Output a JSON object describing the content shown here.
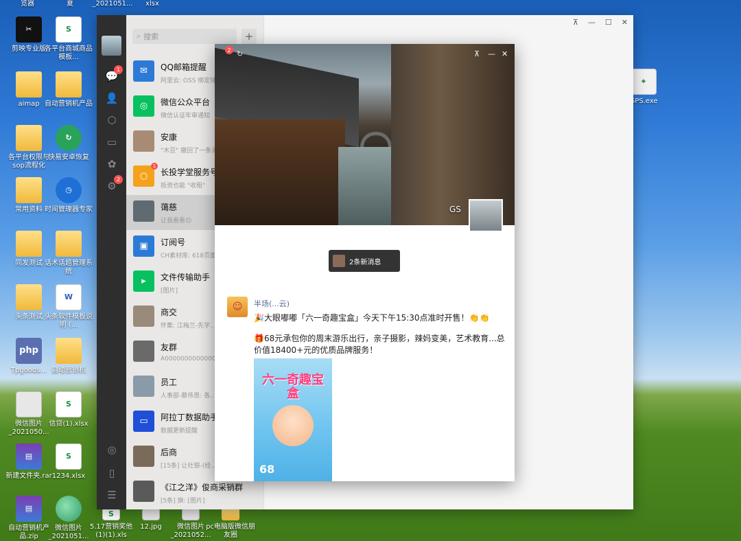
{
  "desktop": {
    "icons": [
      {
        "label": "剪映专业版",
        "kind": "capcut",
        "glyph": "✂"
      },
      {
        "label": "各平台商城商品模板...",
        "kind": "excel",
        "glyph": "S"
      },
      {
        "label": "aimap",
        "kind": "folder",
        "glyph": ""
      },
      {
        "label": "自动营销机产品",
        "kind": "folder",
        "glyph": ""
      },
      {
        "label": "各平台权限与sop流程化",
        "kind": "folder",
        "glyph": ""
      },
      {
        "label": "快易安卓恢复",
        "kind": "recover",
        "glyph": "↻"
      },
      {
        "label": "常用资料",
        "kind": "folder",
        "glyph": ""
      },
      {
        "label": "时间管理器专家",
        "kind": "clock",
        "glyph": "◷"
      },
      {
        "label": "同发测试",
        "kind": "folder",
        "glyph": ""
      },
      {
        "label": "话术话题管理系统",
        "kind": "folder",
        "glyph": ""
      },
      {
        "label": "头条测试",
        "kind": "folder",
        "glyph": ""
      },
      {
        "label": "头条软件模板说明 (...",
        "kind": "word",
        "glyph": "W"
      },
      {
        "label": "Tpgoods...",
        "kind": "php",
        "glyph": "php"
      },
      {
        "label": "自动营销机",
        "kind": "folder",
        "glyph": ""
      },
      {
        "label": "微信图片_2021050...",
        "kind": "img",
        "glyph": ""
      },
      {
        "label": "信贷(1).xlsx",
        "kind": "excel",
        "glyph": "S"
      },
      {
        "label": "新建文件夹.rar",
        "kind": "rar",
        "glyph": "▤"
      },
      {
        "label": "1234.xlsx",
        "kind": "excel",
        "glyph": "S"
      },
      {
        "label": "自动营销机产品.zip",
        "kind": "rar",
        "glyph": "▤"
      },
      {
        "label": "微信图片_2021051...",
        "kind": "ball",
        "glyph": ""
      },
      {
        "label": "5.17营销奖他(1)(1).xls",
        "kind": "excel",
        "glyph": "S"
      },
      {
        "label": "12.jpg",
        "kind": "img",
        "glyph": ""
      },
      {
        "label": "微信图片_2021052...",
        "kind": "img",
        "glyph": ""
      },
      {
        "label": "pc电脑版微信朋友圈",
        "kind": "folder",
        "glyph": ""
      },
      {
        "label": "GPS.exe",
        "kind": "gps",
        "glyph": "⌖"
      }
    ],
    "top_strip": [
      "览器",
      "夏",
      "_2021051...",
      "xlsx"
    ]
  },
  "wechat": {
    "search_placeholder": "搜索",
    "plus_label": "+",
    "rail_badges": {
      "chats": "1",
      "settings": "2"
    },
    "window_controls": {
      "pin": "⊼",
      "min": "—",
      "max": "☐",
      "close": "✕"
    },
    "chats": [
      {
        "name": "QQ邮箱提醒",
        "preview": "阿里云: OSS 绑定域...",
        "avatar_color": "#2d7ad6",
        "glyph": "✉",
        "badge": "",
        "selected": false
      },
      {
        "name": "微信公众平台",
        "preview": "微信认证年审通知",
        "avatar_color": "#07c160",
        "glyph": "◎",
        "badge": "",
        "selected": false
      },
      {
        "name": "安康",
        "preview": "\"木豆\" 撤回了一条消息",
        "avatar_color": "#a88b74",
        "glyph": "",
        "badge": "",
        "selected": false
      },
      {
        "name": "长投学堂服务号",
        "preview": "投资也能 \"收租\"",
        "avatar_color": "#f4a21c",
        "glyph": "○",
        "badge": "1",
        "selected": false
      },
      {
        "name": "蔼慈",
        "preview": "让我看看😊",
        "avatar_color": "#5f6b70",
        "glyph": "",
        "badge": "",
        "selected": true
      },
      {
        "name": "订阅号",
        "preview": "CH素材库: 618页面...",
        "avatar_color": "#2d7ad6",
        "glyph": "▣",
        "badge": "",
        "selected": false
      },
      {
        "name": "文件传输助手",
        "preview": "[图片]",
        "avatar_color": "#07c160",
        "glyph": "▸",
        "badge": "",
        "selected": false
      },
      {
        "name": "商交",
        "preview": "怀集: 江梅兰-先字...",
        "avatar_color": "#9a8a7a",
        "glyph": "",
        "badge": "",
        "selected": false
      },
      {
        "name": "友群",
        "preview": "A000000000000000",
        "avatar_color": "#6a6a6a",
        "glyph": "",
        "badge": "",
        "selected": false
      },
      {
        "name": "员工",
        "preview": "人事部-蔡伟恩: 各...",
        "avatar_color": "#8a9aa8",
        "glyph": "",
        "badge": "",
        "selected": false
      },
      {
        "name": "阿拉丁数据助手",
        "preview": "数据更新提醒",
        "avatar_color": "#1f4fd6",
        "glyph": "▭",
        "badge": "",
        "selected": false
      },
      {
        "name": "后商",
        "preview": "[15条] 让社银-(经...",
        "avatar_color": "#7a6a5a",
        "glyph": "",
        "badge": "",
        "selected": false
      },
      {
        "name": "《江之洋》俊商采销群",
        "preview": "[5条] 旗: [图片]",
        "avatar_color": "#5a5a5a",
        "glyph": "",
        "badge": "",
        "selected": false
      }
    ]
  },
  "moments": {
    "badge": "2",
    "cover_caption": "GS",
    "controls": {
      "pin": "⊼",
      "min": "—",
      "close": "✕"
    },
    "new_message_label": "2条新消息",
    "post": {
      "author": "半场(...云)",
      "line1": "🎉大眼嘟嘟「六一奇趣宝盒」今天下午15:30点准时开售！👏👏",
      "line2": "🎁68元承包你的周末游乐出行，亲子摄影，辣妈变美，艺术教育...总价值18400+元的优质品牌服务！",
      "poster_title": "六一奇趣宝盒",
      "poster_price": "68"
    }
  }
}
